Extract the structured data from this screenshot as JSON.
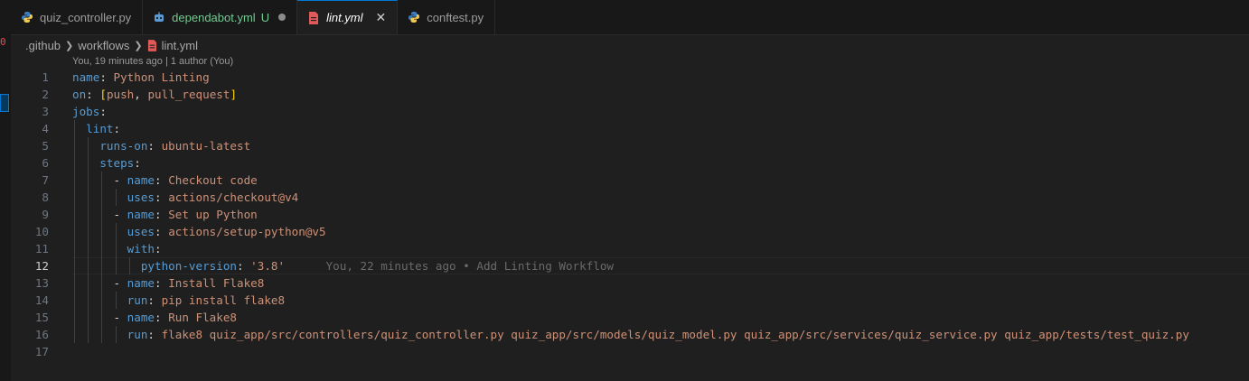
{
  "tabs": [
    {
      "label": "quiz_controller.py",
      "icon": "python-icon",
      "italic": false,
      "active": false
    },
    {
      "label": "dependabot.yml",
      "icon": "bot-icon",
      "status": "U",
      "dirty": true,
      "active": false
    },
    {
      "label": "lint.yml",
      "icon": "yaml-file-icon",
      "italic": true,
      "active": true,
      "close": "✕"
    },
    {
      "label": "conftest.py",
      "icon": "python-icon",
      "active": false
    }
  ],
  "breadcrumb": {
    "items": [
      ".github",
      "workflows",
      "lint.yml"
    ]
  },
  "codelens": "You, 19 minutes ago | 1 author (You)",
  "blame": "You, 22 minutes ago • Add Linting Workflow",
  "colors": {
    "keyword": "#569cd6",
    "string": "#ce9178",
    "accent": "#0078d4",
    "background": "#1f1f1f"
  },
  "lines": [
    {
      "n": "1",
      "tokens": [
        [
          "k",
          "name"
        ],
        [
          "p",
          ": "
        ],
        [
          "s",
          "Python Linting"
        ]
      ]
    },
    {
      "n": "2",
      "tokens": [
        [
          "k",
          "on"
        ],
        [
          "p",
          ": "
        ],
        [
          "br",
          "["
        ],
        [
          "s",
          "push"
        ],
        [
          "p",
          ", "
        ],
        [
          "s",
          "pull_request"
        ],
        [
          "br",
          "]"
        ]
      ]
    },
    {
      "n": "3",
      "tokens": [
        [
          "k",
          "jobs"
        ],
        [
          "p",
          ":"
        ]
      ]
    },
    {
      "n": "4",
      "tokens": [
        [
          "p",
          "  "
        ],
        [
          "k",
          "lint"
        ],
        [
          "p",
          ":"
        ]
      ]
    },
    {
      "n": "5",
      "tokens": [
        [
          "p",
          "    "
        ],
        [
          "k",
          "runs-on"
        ],
        [
          "p",
          ": "
        ],
        [
          "s",
          "ubuntu-latest"
        ]
      ]
    },
    {
      "n": "6",
      "tokens": [
        [
          "p",
          "    "
        ],
        [
          "k",
          "steps"
        ],
        [
          "p",
          ":"
        ]
      ]
    },
    {
      "n": "7",
      "tokens": [
        [
          "p",
          "      "
        ],
        [
          "p",
          "- "
        ],
        [
          "k",
          "name"
        ],
        [
          "p",
          ": "
        ],
        [
          "s",
          "Checkout code"
        ]
      ]
    },
    {
      "n": "8",
      "tokens": [
        [
          "p",
          "        "
        ],
        [
          "k",
          "uses"
        ],
        [
          "p",
          ": "
        ],
        [
          "s",
          "actions/checkout@v4"
        ]
      ]
    },
    {
      "n": "9",
      "tokens": [
        [
          "p",
          "      "
        ],
        [
          "p",
          "- "
        ],
        [
          "k",
          "name"
        ],
        [
          "p",
          ": "
        ],
        [
          "s",
          "Set up Python"
        ]
      ]
    },
    {
      "n": "10",
      "tokens": [
        [
          "p",
          "        "
        ],
        [
          "k",
          "uses"
        ],
        [
          "p",
          ": "
        ],
        [
          "s",
          "actions/setup-python@v5"
        ]
      ]
    },
    {
      "n": "11",
      "tokens": [
        [
          "p",
          "        "
        ],
        [
          "k",
          "with"
        ],
        [
          "p",
          ":"
        ]
      ]
    },
    {
      "n": "12",
      "tokens": [
        [
          "p",
          "          "
        ],
        [
          "k",
          "python-version"
        ],
        [
          "p",
          ": "
        ],
        [
          "s",
          "'3.8'"
        ]
      ],
      "current": true
    },
    {
      "n": "13",
      "tokens": [
        [
          "p",
          "      "
        ],
        [
          "p",
          "- "
        ],
        [
          "k",
          "name"
        ],
        [
          "p",
          ": "
        ],
        [
          "s",
          "Install Flake8"
        ]
      ]
    },
    {
      "n": "14",
      "tokens": [
        [
          "p",
          "        "
        ],
        [
          "k",
          "run"
        ],
        [
          "p",
          ": "
        ],
        [
          "s",
          "pip install flake8"
        ]
      ]
    },
    {
      "n": "15",
      "tokens": [
        [
          "p",
          "      "
        ],
        [
          "p",
          "- "
        ],
        [
          "k",
          "name"
        ],
        [
          "p",
          ": "
        ],
        [
          "s",
          "Run Flake8"
        ]
      ]
    },
    {
      "n": "16",
      "tokens": [
        [
          "p",
          "        "
        ],
        [
          "k",
          "run"
        ],
        [
          "p",
          ": "
        ],
        [
          "s",
          "flake8 quiz_app/src/controllers/quiz_controller.py quiz_app/src/models/quiz_model.py quiz_app/src/services/quiz_service.py quiz_app/tests/test_quiz.py"
        ]
      ]
    },
    {
      "n": "17",
      "tokens": []
    }
  ]
}
